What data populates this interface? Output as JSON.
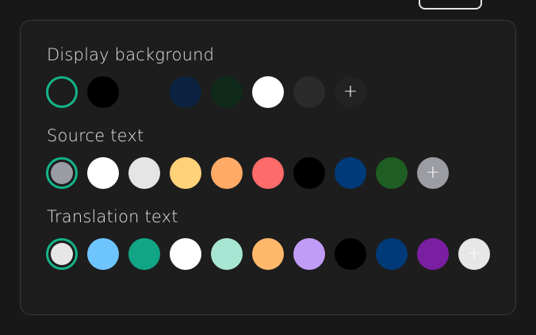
{
  "sections": [
    {
      "label": "Display background",
      "swatches": [
        "#1d1d1d",
        "#000000",
        "#1d1d1d",
        "#0b2340",
        "#0f2a1a",
        "#ffffff",
        "#2b2b2b"
      ],
      "selected_index": 0,
      "add": {
        "symbol": "+",
        "bg": "#222222",
        "color": "#ffffff"
      }
    },
    {
      "label": "Source text",
      "swatches": [
        "#9a9ca3",
        "#ffffff",
        "#e5e5e5",
        "#ffd27a",
        "#ffaa66",
        "#ff6a6a",
        "#000000",
        "#003a78",
        "#1e5e22"
      ],
      "selected_index": 0,
      "add": {
        "symbol": "+",
        "bg": "#9b9da3",
        "color": "#ffffff"
      }
    },
    {
      "label": "Translation text",
      "swatches": [
        "#e6e6e6",
        "#6ec4ff",
        "#12a585",
        "#ffffff",
        "#a7e6d2",
        "#ffb86b",
        "#c19cf7",
        "#000000",
        "#003a78",
        "#7b1fa2"
      ],
      "selected_index": 0,
      "add": {
        "symbol": "+",
        "bg": "#e7e7e7",
        "color": "#ffffff"
      }
    }
  ],
  "accent_color": "#14b48a"
}
